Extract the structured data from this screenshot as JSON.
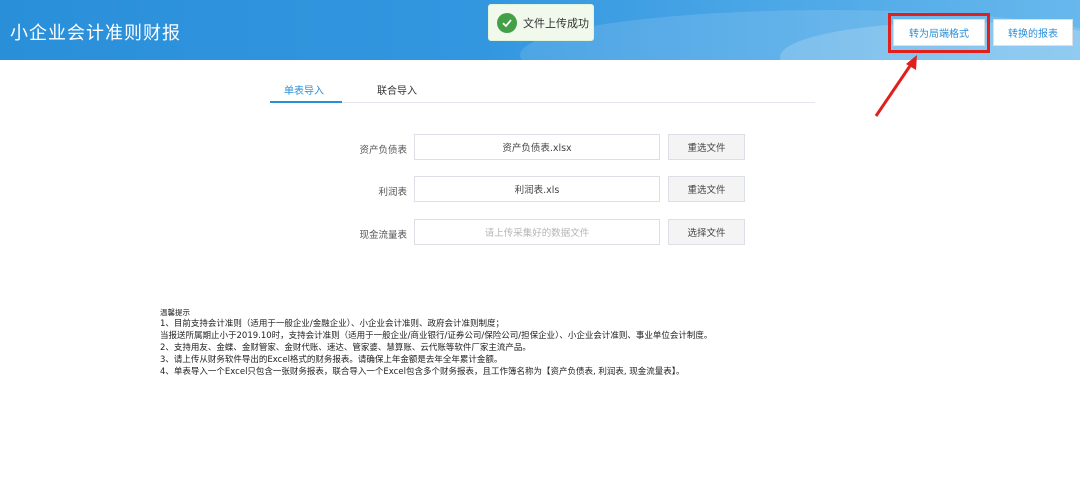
{
  "header": {
    "title": "小企业会计准则财报",
    "convert_button": "转为局端格式",
    "converted_button": "转换的报表"
  },
  "toast": {
    "message": "文件上传成功",
    "icon": "check-circle-icon"
  },
  "tabs": [
    {
      "label": "单表导入",
      "active": true
    },
    {
      "label": "联合导入",
      "active": false
    }
  ],
  "upload_rows": [
    {
      "label": "资产负债表",
      "file": "资产负债表.xlsx",
      "placeholder": "",
      "button": "重选文件"
    },
    {
      "label": "利润表",
      "file": "利润表.xls",
      "placeholder": "",
      "button": "重选文件"
    },
    {
      "label": "现金流量表",
      "file": "",
      "placeholder": "请上传采集好的数据文件",
      "button": "选择文件"
    }
  ],
  "notes": {
    "heading": "温馨提示",
    "lines": [
      "1、目前支持会计准则（适用于一般企业/金融企业）、小企业会计准则、政府会计准则制度；",
      "当报送所属期止小于2019.10时，支持会计准则（适用于一般企业/商业银行/证券公司/保险公司/担保企业）、小企业会计准则、事业单位会计制度。",
      "2、支持用友、金蝶、金财管家、金财代账、速达、管家婆、慧算账、云代账等软件厂家主流产品。",
      "3、请上传从财务软件导出的Excel格式的财务报表。请确保上年金额是去年全年累计金额。",
      "4、单表导入一个Excel只包含一张财务报表，联合导入一个Excel包含多个财务报表，且工作簿名称为【资产负债表, 利润表, 现金流量表】。"
    ]
  },
  "colors": {
    "header": "#3397e0",
    "accent": "#2a8fd9",
    "success": "#43a047",
    "highlight": "#e0201c"
  }
}
